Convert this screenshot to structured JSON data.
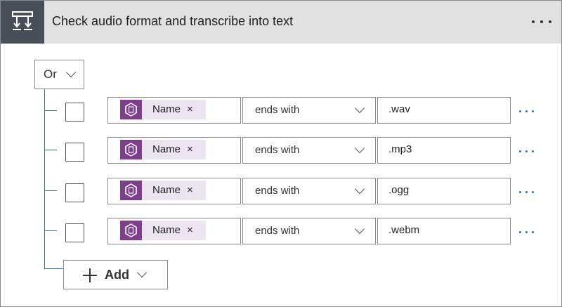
{
  "header": {
    "title": "Check audio format and transcribe into text",
    "icon": "condition-icon",
    "accent": "#484f58"
  },
  "group": {
    "operator": "Or"
  },
  "conditions": [
    {
      "token": "Name",
      "token_icon": "dynamic-content-icon",
      "remove": "×",
      "operator": "ends with",
      "value": ".wav"
    },
    {
      "token": "Name",
      "token_icon": "dynamic-content-icon",
      "remove": "×",
      "operator": "ends with",
      "value": ".mp3"
    },
    {
      "token": "Name",
      "token_icon": "dynamic-content-icon",
      "remove": "×",
      "operator": "ends with",
      "value": ".ogg"
    },
    {
      "token": "Name",
      "token_icon": "dynamic-content-icon",
      "remove": "×",
      "operator": "ends with",
      "value": ".webm"
    }
  ],
  "add_button": {
    "label": "Add"
  },
  "colors": {
    "token_bg": "#ece4f1",
    "token_icon_bg": "#7d3e8c",
    "connector": "#2f6fb0",
    "header_bg": "#e1e1e1"
  }
}
